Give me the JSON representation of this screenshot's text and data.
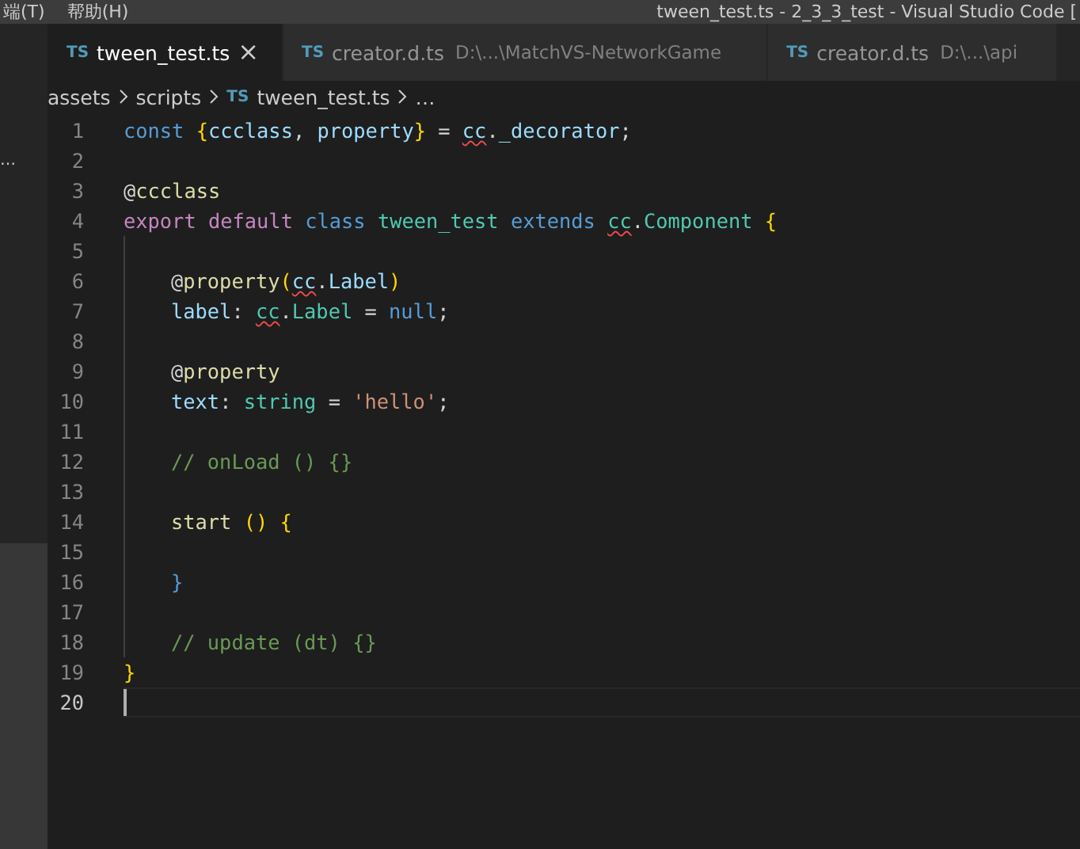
{
  "menu_bar": {
    "items": [
      "端(T)",
      "帮助(H)"
    ],
    "title": "tween_test.ts - 2_3_3_test - Visual Studio Code ["
  },
  "sidebar": {
    "overflow_text": "…"
  },
  "tabs": [
    {
      "icon_text": "TS",
      "label": "tween_test.ts",
      "close_icon": "×",
      "selected": true
    },
    {
      "icon_text": "TS",
      "label": "creator.d.ts",
      "path": "D:\\...\\MatchVS-NetworkGame",
      "selected": false
    },
    {
      "icon_text": "TS",
      "label": "creator.d.ts",
      "path": "D:\\...\\api",
      "selected": false
    }
  ],
  "breadcrumb": [
    {
      "label": "assets"
    },
    {
      "label": "scripts"
    },
    {
      "icon_text": "TS",
      "label": "tween_test.ts"
    },
    {
      "label": "…"
    }
  ],
  "editor": {
    "lines": [
      {
        "number": "1",
        "current": false,
        "tokens": [
          {
            "t": "const ",
            "kind": "kw"
          },
          {
            "t": "{",
            "kind": "brace"
          },
          {
            "t": "ccclass",
            "kind": "var"
          },
          {
            "t": ", ",
            "kind": "plain"
          },
          {
            "t": "property",
            "kind": "var"
          },
          {
            "t": "}",
            "kind": "brace"
          },
          {
            "t": " = ",
            "kind": "plain"
          },
          {
            "t": "cc",
            "kind": "var",
            "error": true
          },
          {
            "t": ".",
            "kind": "plain"
          },
          {
            "t": "_decorator",
            "kind": "var"
          },
          {
            "t": ";",
            "kind": "plain"
          }
        ]
      },
      {
        "number": "2",
        "current": false
      },
      {
        "number": "3",
        "current": false,
        "tokens": [
          {
            "t": "@",
            "kind": "plain"
          },
          {
            "t": "ccclass",
            "kind": "fn"
          }
        ]
      },
      {
        "number": "4",
        "current": false,
        "tokens": [
          {
            "t": "export ",
            "kind": "kw2"
          },
          {
            "t": "default ",
            "kind": "kw2"
          },
          {
            "t": "class ",
            "kind": "kw"
          },
          {
            "t": "tween_test ",
            "kind": "type"
          },
          {
            "t": "extends ",
            "kind": "kw"
          },
          {
            "t": "cc",
            "kind": "type",
            "error": true
          },
          {
            "t": ".",
            "kind": "plain"
          },
          {
            "t": "Component ",
            "kind": "type"
          },
          {
            "t": "{",
            "kind": "brace"
          }
        ]
      },
      {
        "number": "5",
        "current": false,
        "indent": true
      },
      {
        "number": "6",
        "current": false,
        "indent": true,
        "tokens": [
          {
            "t": "@",
            "kind": "plain"
          },
          {
            "t": "property",
            "kind": "fn"
          },
          {
            "t": "(",
            "kind": "brace"
          },
          {
            "t": "cc",
            "kind": "var",
            "error": true
          },
          {
            "t": ".",
            "kind": "plain"
          },
          {
            "t": "Label",
            "kind": "var"
          },
          {
            "t": ")",
            "kind": "brace"
          }
        ]
      },
      {
        "number": "7",
        "current": false,
        "indent": true,
        "tokens": [
          {
            "t": "label",
            "kind": "var"
          },
          {
            "t": ": ",
            "kind": "plain"
          },
          {
            "t": "cc",
            "kind": "type",
            "error": true
          },
          {
            "t": ".",
            "kind": "plain"
          },
          {
            "t": "Label",
            "kind": "type"
          },
          {
            "t": " = ",
            "kind": "plain"
          },
          {
            "t": "null",
            "kind": "kw"
          },
          {
            "t": ";",
            "kind": "plain"
          }
        ]
      },
      {
        "number": "8",
        "current": false,
        "indent": true
      },
      {
        "number": "9",
        "current": false,
        "indent": true,
        "tokens": [
          {
            "t": "@",
            "kind": "plain"
          },
          {
            "t": "property",
            "kind": "fn"
          }
        ]
      },
      {
        "number": "10",
        "current": false,
        "indent": true,
        "tokens": [
          {
            "t": "text",
            "kind": "var"
          },
          {
            "t": ": ",
            "kind": "plain"
          },
          {
            "t": "string",
            "kind": "type"
          },
          {
            "t": " = ",
            "kind": "plain"
          },
          {
            "t": "'hello'",
            "kind": "str"
          },
          {
            "t": ";",
            "kind": "plain"
          }
        ]
      },
      {
        "number": "11",
        "current": false,
        "indent": true
      },
      {
        "number": "12",
        "current": false,
        "indent": true,
        "tokens": [
          {
            "t": "// onLoad () {}",
            "kind": "com"
          }
        ]
      },
      {
        "number": "13",
        "current": false,
        "indent": true
      },
      {
        "number": "14",
        "current": false,
        "indent": true,
        "tokens": [
          {
            "t": "start ",
            "kind": "fn"
          },
          {
            "t": "() ",
            "kind": "brace"
          },
          {
            "t": "{",
            "kind": "brace"
          }
        ]
      },
      {
        "number": "15",
        "current": false,
        "indent": true
      },
      {
        "number": "16",
        "current": false,
        "indent": true,
        "tokens": [
          {
            "t": "}",
            "kind": "kw"
          }
        ]
      },
      {
        "number": "17",
        "current": false,
        "indent": true
      },
      {
        "number": "18",
        "current": false,
        "indent": true,
        "tokens": [
          {
            "t": "// update (dt) {}",
            "kind": "com"
          }
        ]
      },
      {
        "number": "19",
        "current": false,
        "tokens": [
          {
            "t": "}",
            "kind": "brace"
          }
        ]
      },
      {
        "number": "20",
        "current": true
      }
    ]
  }
}
